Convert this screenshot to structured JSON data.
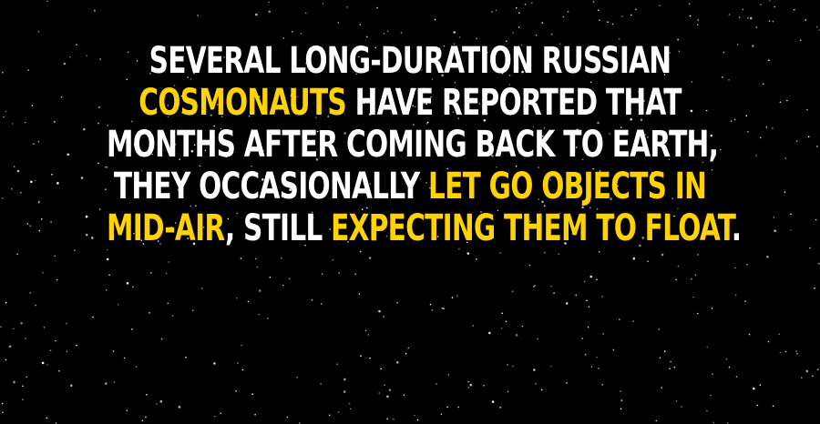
{
  "colors": {
    "background": "#000000",
    "text": "#ffffff",
    "highlight": "#ffd200",
    "stars": "#ffffff"
  },
  "fact": {
    "line1": {
      "text": "SEVERAL LONG-DURATION RUSSIAN"
    },
    "line2": {
      "highlight": "COSMONAUTS",
      "text": " HAVE REPORTED THAT"
    },
    "line3": {
      "text": "MONTHS AFTER COMING BACK TO EARTH,"
    },
    "line4": {
      "text": "THEY OCCASIONALLY ",
      "highlight": "LET GO OBJECTS IN"
    },
    "line5": {
      "highlight_a": "MID-AIR",
      "text_a": ", STILL ",
      "highlight_b": "EXPECTING THEM TO FLOAT",
      "text_b": "."
    }
  }
}
